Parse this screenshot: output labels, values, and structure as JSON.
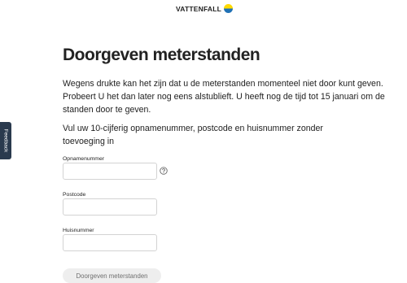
{
  "header": {
    "brand": "VATTENFALL",
    "logo_icon": "vattenfall-logo-icon"
  },
  "feedback_tab": {
    "label": "Feedback"
  },
  "page": {
    "title": "Doorgeven meterstanden",
    "notice": "Wegens drukte kan het zijn dat u de meterstanden momenteel niet door kunt geven. Probeert U het dan later nog eens alstublieft. U heeft nog de tijd tot 15 januari om de standen door te geven.",
    "instructions": "Vul uw 10-cijferig opnamenummer, postcode en huisnummer zonder toevoeging in"
  },
  "form": {
    "opnamenummer": {
      "label": "Opnamenummer",
      "value": "",
      "help_icon": "question-circle-icon"
    },
    "postcode": {
      "label": "Postcode",
      "value": ""
    },
    "huisnummer": {
      "label": "Huisnummer",
      "value": ""
    },
    "submit_label": "Doorgeven meterstanden"
  },
  "colors": {
    "logo_blue": "#2071b5",
    "logo_yellow": "#ffda00",
    "feedback_bg": "#2a3a4e",
    "button_bg": "#eeeeee",
    "button_text": "#6f6f6f"
  }
}
